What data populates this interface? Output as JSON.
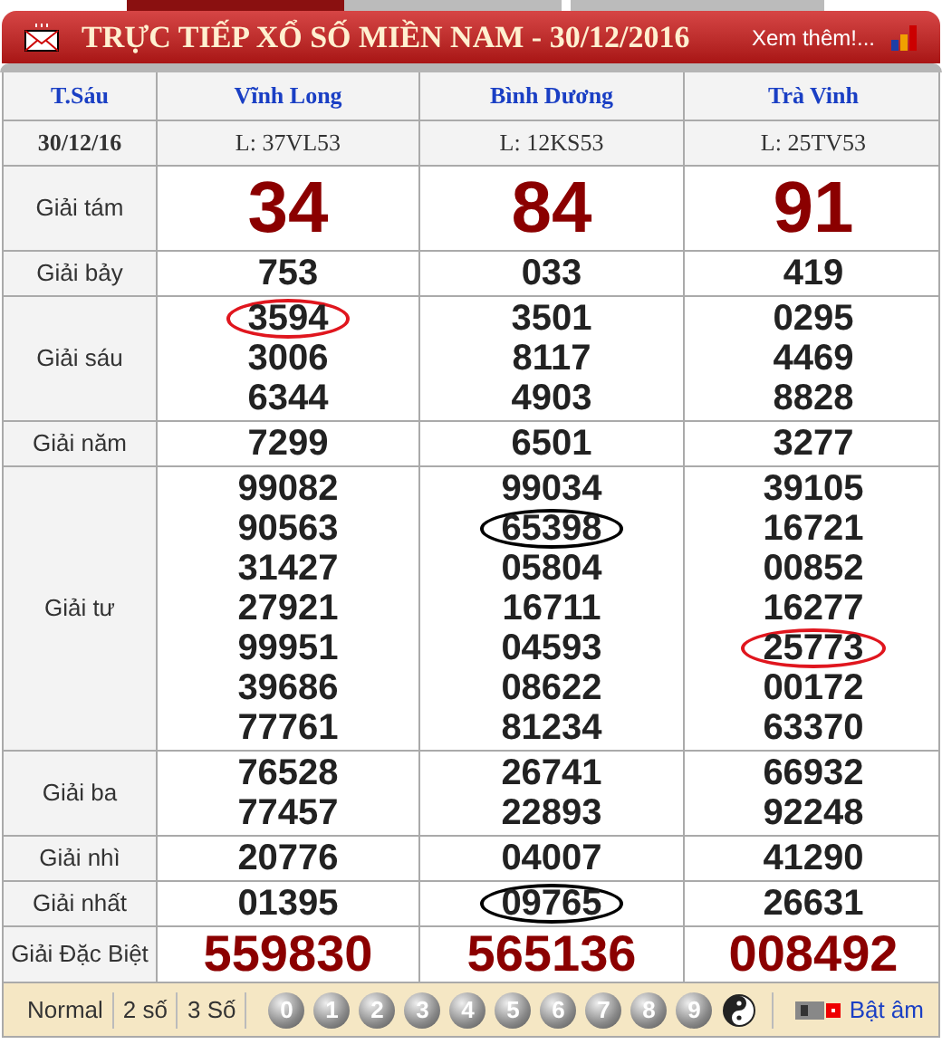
{
  "header": {
    "title": "TRỰC TIẾP XỔ SỐ MIỀN NAM - 30/12/2016",
    "more_link": "Xem thêm!..."
  },
  "table": {
    "weekday": "T.Sáu",
    "columns": [
      "Vĩnh Long",
      "Bình Dương",
      "Trà Vinh"
    ],
    "draw_date": "30/12/16",
    "ticket_codes": [
      "L: 37VL53",
      "L: 12KS53",
      "L: 25TV53"
    ],
    "rows": [
      {
        "label": "Giải tám",
        "kind": "big",
        "cells": [
          [
            {
              "text": "34",
              "circled": false
            }
          ],
          [
            {
              "text": "84",
              "circled": false
            }
          ],
          [
            {
              "text": "91",
              "circled": false
            }
          ]
        ]
      },
      {
        "label": "Giải bảy",
        "kind": "normal",
        "cells": [
          [
            {
              "text": "753",
              "circled": false
            }
          ],
          [
            {
              "text": "033",
              "circled": false
            }
          ],
          [
            {
              "text": "419",
              "circled": false
            }
          ]
        ]
      },
      {
        "label": "Giải sáu",
        "kind": "normal",
        "cells": [
          [
            {
              "text": "3594",
              "circled": true,
              "color": "#e0161e"
            },
            {
              "text": "3006",
              "circled": false
            },
            {
              "text": "6344",
              "circled": false
            }
          ],
          [
            {
              "text": "3501",
              "circled": false
            },
            {
              "text": "8117",
              "circled": false
            },
            {
              "text": "4903",
              "circled": false
            }
          ],
          [
            {
              "text": "0295",
              "circled": false
            },
            {
              "text": "4469",
              "circled": false
            },
            {
              "text": "8828",
              "circled": false
            }
          ]
        ]
      },
      {
        "label": "Giải năm",
        "kind": "normal",
        "cells": [
          [
            {
              "text": "7299",
              "circled": false
            }
          ],
          [
            {
              "text": "6501",
              "circled": false
            }
          ],
          [
            {
              "text": "3277",
              "circled": false
            }
          ]
        ]
      },
      {
        "label": "Giải tư",
        "kind": "normal",
        "cells": [
          [
            {
              "text": "99082",
              "circled": false
            },
            {
              "text": "90563",
              "circled": false
            },
            {
              "text": "31427",
              "circled": false
            },
            {
              "text": "27921",
              "circled": false
            },
            {
              "text": "99951",
              "circled": false
            },
            {
              "text": "39686",
              "circled": false
            },
            {
              "text": "77761",
              "circled": false
            }
          ],
          [
            {
              "text": "99034",
              "circled": false
            },
            {
              "text": "65398",
              "circled": true,
              "color": "#000000"
            },
            {
              "text": "05804",
              "circled": false
            },
            {
              "text": "16711",
              "circled": false
            },
            {
              "text": "04593",
              "circled": false
            },
            {
              "text": "08622",
              "circled": false
            },
            {
              "text": "81234",
              "circled": false
            }
          ],
          [
            {
              "text": "39105",
              "circled": false
            },
            {
              "text": "16721",
              "circled": false
            },
            {
              "text": "00852",
              "circled": false
            },
            {
              "text": "16277",
              "circled": false
            },
            {
              "text": "25773",
              "circled": true,
              "color": "#e0161e"
            },
            {
              "text": "00172",
              "circled": false
            },
            {
              "text": "63370",
              "circled": false
            }
          ]
        ]
      },
      {
        "label": "Giải ba",
        "kind": "normal",
        "cells": [
          [
            {
              "text": "76528",
              "circled": false
            },
            {
              "text": "77457",
              "circled": false
            }
          ],
          [
            {
              "text": "26741",
              "circled": false
            },
            {
              "text": "22893",
              "circled": false
            }
          ],
          [
            {
              "text": "66932",
              "circled": false
            },
            {
              "text": "92248",
              "circled": false
            }
          ]
        ]
      },
      {
        "label": "Giải nhì",
        "kind": "normal",
        "cells": [
          [
            {
              "text": "20776",
              "circled": false
            }
          ],
          [
            {
              "text": "04007",
              "circled": false
            }
          ],
          [
            {
              "text": "41290",
              "circled": false
            }
          ]
        ]
      },
      {
        "label": "Giải nhất",
        "kind": "normal",
        "cells": [
          [
            {
              "text": "01395",
              "circled": false
            }
          ],
          [
            {
              "text": "09765",
              "circled": true,
              "color": "#000000"
            }
          ],
          [
            {
              "text": "26631",
              "circled": false
            }
          ]
        ]
      },
      {
        "label": "Giải Đặc Biệt",
        "kind": "special",
        "cells": [
          [
            {
              "text": "559830",
              "circled": false
            }
          ],
          [
            {
              "text": "565136",
              "circled": false
            }
          ],
          [
            {
              "text": "008492",
              "circled": false
            }
          ]
        ]
      }
    ]
  },
  "footer": {
    "modes": [
      "Normal",
      "2 số",
      "3 Số"
    ],
    "digits": [
      "0",
      "1",
      "2",
      "3",
      "4",
      "5",
      "6",
      "7",
      "8",
      "9"
    ],
    "sound_link": "Bật âm"
  }
}
